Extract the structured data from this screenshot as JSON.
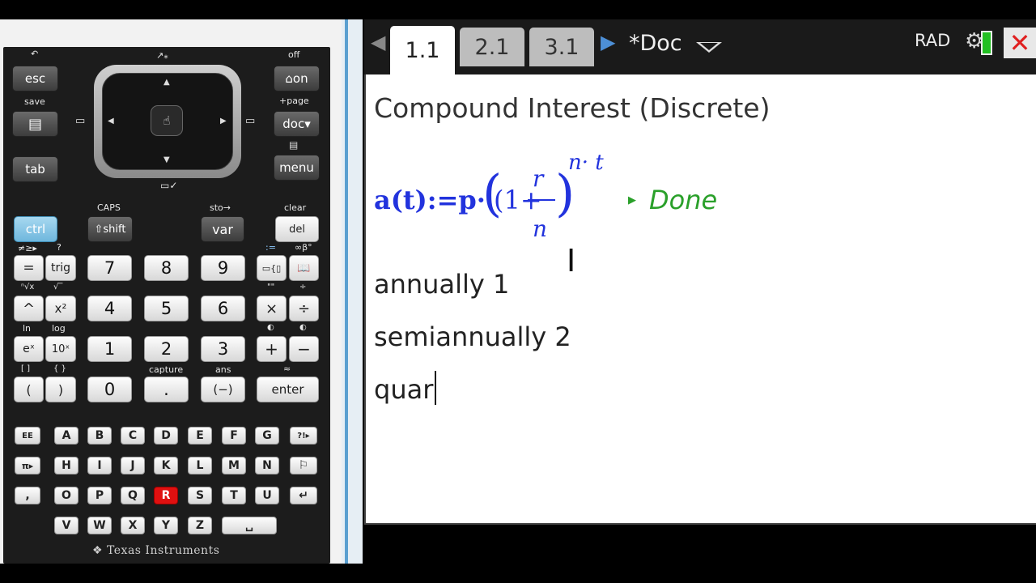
{
  "keypad": {
    "esc_hint": "↶",
    "esc": "esc",
    "save_hint": "save",
    "scratch_icon": "scratchpad-icon",
    "tab": "tab",
    "dpad_top_hint": "↗⁎",
    "dpad_bottom_hint": "▭✓",
    "off_hint": "off",
    "on": "⌂on",
    "page_hint": "+page",
    "doc": "doc▾",
    "menu": "menu",
    "caps_hint": "CAPS",
    "ctrl": "ctrl",
    "shift": "⇧shift",
    "sto_hint": "sto→",
    "var": "var",
    "clear_hint": "clear",
    "del": "del",
    "ineq_hint": "≠≥▸",
    "help_hint": "?",
    "eq": "=",
    "trig": "trig",
    "k7": "7",
    "k8": "8",
    "k9": "9",
    "tmpl_hint": ":=",
    "inf_hint": "∞β°",
    "templates": "▭{▯",
    "catalog": "📖",
    "root_hint": "ⁿ√x",
    "sqrt_hint": "√‾",
    "caret": "^",
    "sq": "x²",
    "k4": "4",
    "k5": "5",
    "k6": "6",
    "quote_hint": "\"\"",
    "div_hint": "÷",
    "mult": "×",
    "div": "÷",
    "ln_hint": "ln",
    "log_hint": "log",
    "ex": "eˣ",
    "tenx": "10ˣ",
    "k1": "1",
    "k2": "2",
    "k3": "3",
    "plus_hint": "◐",
    "minus_hint": "◐",
    "plus": "+",
    "minus": "−",
    "bracket_hint": "[ ]",
    "brace_hint": "{ }",
    "lparen": "(",
    "rparen": ")",
    "k0": "0",
    "capture_hint": "capture",
    "dot": ".",
    "ans_hint": "ans",
    "neg": "(−)",
    "approx_hint": "≈",
    "enter": "enter",
    "ee": "EE",
    "pi": "π▸",
    "comma": ",",
    "punct": "?!▸",
    "flag": "⚐",
    "ret": "↵",
    "space": "␣",
    "alpha_row1": [
      "A",
      "B",
      "C",
      "D",
      "E",
      "F",
      "G"
    ],
    "alpha_row2": [
      "H",
      "I",
      "J",
      "K",
      "L",
      "M",
      "N"
    ],
    "alpha_row3": [
      "O",
      "P",
      "Q",
      "R",
      "S",
      "T",
      "U"
    ],
    "alpha_row4": [
      "V",
      "W",
      "X",
      "Y",
      "Z"
    ],
    "logo": "Texas Instruments"
  },
  "tabs": [
    "1.1",
    "2.1",
    "3.1"
  ],
  "doc_title": "*Doc",
  "mode": "RAD",
  "close": "✕",
  "notes": {
    "heading": "Compound Interest (Discrete)",
    "formula_lhs": "a(t):=p·",
    "formula_one": "(1+",
    "formula_num": "r",
    "formula_den": "n",
    "formula_close": ")",
    "formula_exp": "n· t",
    "done": "Done",
    "line1": "annually 1",
    "line2": "semiannually 2",
    "line3": "quar"
  },
  "colors": {
    "formula": "#2233dd",
    "done": "#2aa02a",
    "ctrl": "#6fb7dd",
    "close": "#e02020"
  }
}
